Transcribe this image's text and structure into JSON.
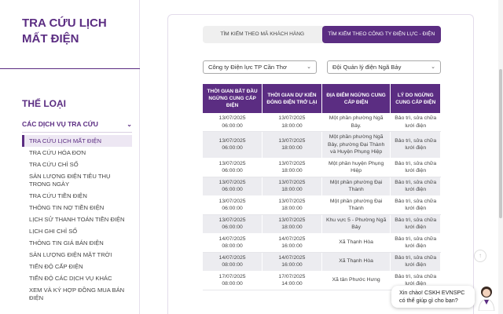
{
  "sidebar": {
    "title": "TRA CỨU LỊCH MẤT ĐIỆN",
    "section_title": "THỂ LOẠI",
    "group_label": "CÁC DỊCH VỤ TRA CỨU",
    "items": [
      {
        "label": "TRA CỨU LỊCH MẤT ĐIỆN"
      },
      {
        "label": "TRA CỨU HÓA ĐƠN"
      },
      {
        "label": "TRA CỨU CHỈ SỐ"
      },
      {
        "label": "SẢN LƯỢNG ĐIỆN TIÊU THỤ TRONG NGÀY"
      },
      {
        "label": "TRA CỨU TIỀN ĐIỆN"
      },
      {
        "label": "THÔNG TIN NỢ TIỀN ĐIỆN"
      },
      {
        "label": "LỊCH SỬ THANH TOÁN TIỀN ĐIỆN"
      },
      {
        "label": "LỊCH GHI CHỈ SỐ"
      },
      {
        "label": "THÔNG TIN GIÁ BÁN ĐIỆN"
      },
      {
        "label": "SẢN LƯỢNG ĐIỆN MẶT TRỜI"
      },
      {
        "label": "TIẾN ĐỘ CẤP ĐIỆN"
      },
      {
        "label": "TIẾN ĐỘ CÁC DỊCH VỤ KHÁC"
      },
      {
        "label": "XEM VÀ KÝ HỢP ĐỒNG MUA BÁN ĐIỆN"
      }
    ]
  },
  "tabs": [
    {
      "label": "TÌM KIẾM THEO MÃ KHÁCH HÀNG"
    },
    {
      "label": "TÌM KIẾM THEO CÔNG TY ĐIỆN LỰC - ĐIỆN LỰC"
    }
  ],
  "filters": {
    "company": "Công ty Điện lực TP Cần Thơ",
    "unit": "Đội Quản lý điện Ngã Bảy"
  },
  "table": {
    "headers": [
      "THỜI GIAN BẮT ĐẦU NGỪNG CUNG CẤP ĐIỆN",
      "THỜI GIAN DỰ KIẾN ĐÓNG ĐIỆN TRỞ LẠI",
      "ĐỊA ĐIỂM NGỪNG CUNG CẤP ĐIỆN",
      "LÝ DO NGỪNG CUNG CẤP ĐIỆN"
    ],
    "rows": [
      {
        "start_date": "13/07/2025",
        "start_time": "06:00:00",
        "end_date": "13/07/2025",
        "end_time": "18:00:00",
        "location": "Một phần phường Ngã Bảy.",
        "reason": "Bảo trì, sửa chữa lưới điện"
      },
      {
        "start_date": "13/07/2025",
        "start_time": "06:00:00",
        "end_date": "13/07/2025",
        "end_time": "18:00:00",
        "location": "Một phần phường Ngã Bảy, phường Đại Thành và Huyện Phụng Hiệp",
        "reason": "Bảo trì, sửa chữa lưới điện"
      },
      {
        "start_date": "13/07/2025",
        "start_time": "06:00:00",
        "end_date": "13/07/2025",
        "end_time": "18:00:00",
        "location": "Một phần huyện Phụng Hiệp",
        "reason": "Bảo trì, sửa chữa lưới điện"
      },
      {
        "start_date": "13/07/2025",
        "start_time": "06:00:00",
        "end_date": "13/07/2025",
        "end_time": "18:00:00",
        "location": "Một phần phường Đại Thành",
        "reason": "Bảo trì, sửa chữa lưới điện"
      },
      {
        "start_date": "13/07/2025",
        "start_time": "06:00:00",
        "end_date": "13/07/2025",
        "end_time": "18:00:00",
        "location": "Một phần phường Đại Thành",
        "reason": "Bảo trì, sửa chữa lưới điện"
      },
      {
        "start_date": "13/07/2025",
        "start_time": "06:00:00",
        "end_date": "13/07/2025",
        "end_time": "18:00:00",
        "location": "Khu vực 5 - Phường Ngã Bảy",
        "reason": "Bảo trì, sửa chữa lưới điện"
      },
      {
        "start_date": "14/07/2025",
        "start_time": "08:00:00",
        "end_date": "14/07/2025",
        "end_time": "16:00:00",
        "location": "Xã Thạnh Hòa",
        "reason": "Bảo trì, sửa chữa lưới điện"
      },
      {
        "start_date": "14/07/2025",
        "start_time": "08:00:00",
        "end_date": "14/07/2025",
        "end_time": "16:00:00",
        "location": "Xã Thạnh Hòa",
        "reason": "Bảo trì, sửa chữa lưới điện"
      },
      {
        "start_date": "17/07/2025",
        "start_time": "08:00:00",
        "end_date": "17/07/2025",
        "end_time": "14:00:00",
        "location": "Xã tân Phước Hưng",
        "reason": "Bảo trì, sửa chữa lưới điện"
      }
    ]
  },
  "chat": {
    "line1": "Xin chào! CSKH EVNSPC",
    "line2": "có thể giúp gì cho bạn?"
  },
  "colors": {
    "primary": "#5b2d82",
    "row_alt": "#ececf0"
  },
  "icons": {
    "group_toggle": "chevron-down-icon",
    "select_toggle": "chevron-down-icon",
    "scroll_top": "arrow-up-icon",
    "chat": "chat-avatar-icon"
  }
}
